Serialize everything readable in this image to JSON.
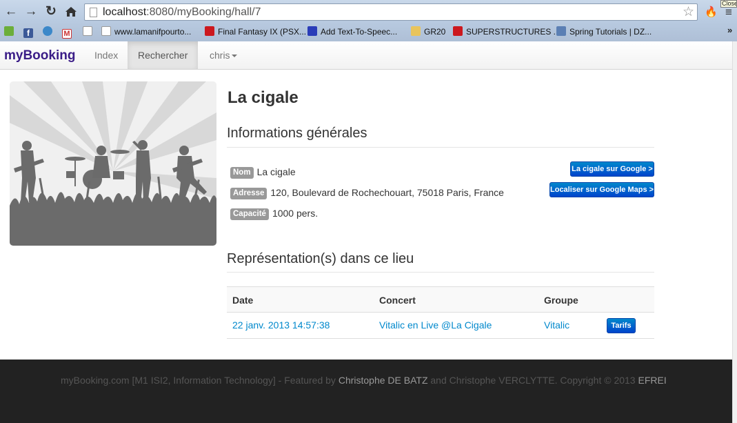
{
  "browser": {
    "url_host": "localhost",
    "url_path": ":8080/myBooking/hall/7",
    "close_tooltip": "Close",
    "bookmarks": [
      {
        "label": "www.lamanifpourto...",
        "icon": "page-icon",
        "color": "#ffffff"
      },
      {
        "label": "Final Fantasy IX (PSX...",
        "icon": "youtube-icon",
        "color": "#cc181e"
      },
      {
        "label": "Add Text-To-Speec...",
        "icon": "extension-icon",
        "color": "#2a3cb8"
      },
      {
        "label": "GR20",
        "icon": "folder-icon",
        "color": "#e9c45c"
      },
      {
        "label": "SUPERSTRUCTURES ...",
        "icon": "youtube-icon",
        "color": "#cc181e"
      },
      {
        "label": "Spring Tutorials | DZ...",
        "icon": "dzone-icon",
        "color": "#5b7fb4"
      }
    ]
  },
  "navbar": {
    "brand": "myBooking",
    "links": [
      "Index",
      "Rechercher",
      "chris"
    ],
    "active": "Rechercher"
  },
  "venue": {
    "title": "La cigale",
    "info_heading": "Informations générales",
    "fields": [
      {
        "label": "Nom",
        "value": "La cigale"
      },
      {
        "label": "Adresse",
        "value": "120, Boulevard de Rochechouart, 75018 Paris, France"
      },
      {
        "label": "Capacité",
        "value": "1000 pers."
      }
    ],
    "google_button": "La cigale sur Google >",
    "maps_button": "Localiser sur Google Maps >"
  },
  "representations": {
    "heading": "Représentation(s) dans ce lieu",
    "columns": [
      "Date",
      "Concert",
      "Groupe"
    ],
    "rows": [
      {
        "date": "22 janv. 2013 14:57:38",
        "concert": "Vitalic en Live @La Cigale",
        "group": "Vitalic",
        "button": "Tarifs"
      }
    ]
  },
  "footer": {
    "part1": "myBooking.com [M1 ISI2, Information Technology] - Featured by ",
    "author1": "Christophe DE BATZ",
    "part2": " and Christophe VERCLYTTE. Copyright © 2013 ",
    "org": "EFREI"
  },
  "colors": {
    "brand": "#3a1c87",
    "link": "#0088cc",
    "primary_button": "#0055cc",
    "footer_bg": "#222222"
  }
}
